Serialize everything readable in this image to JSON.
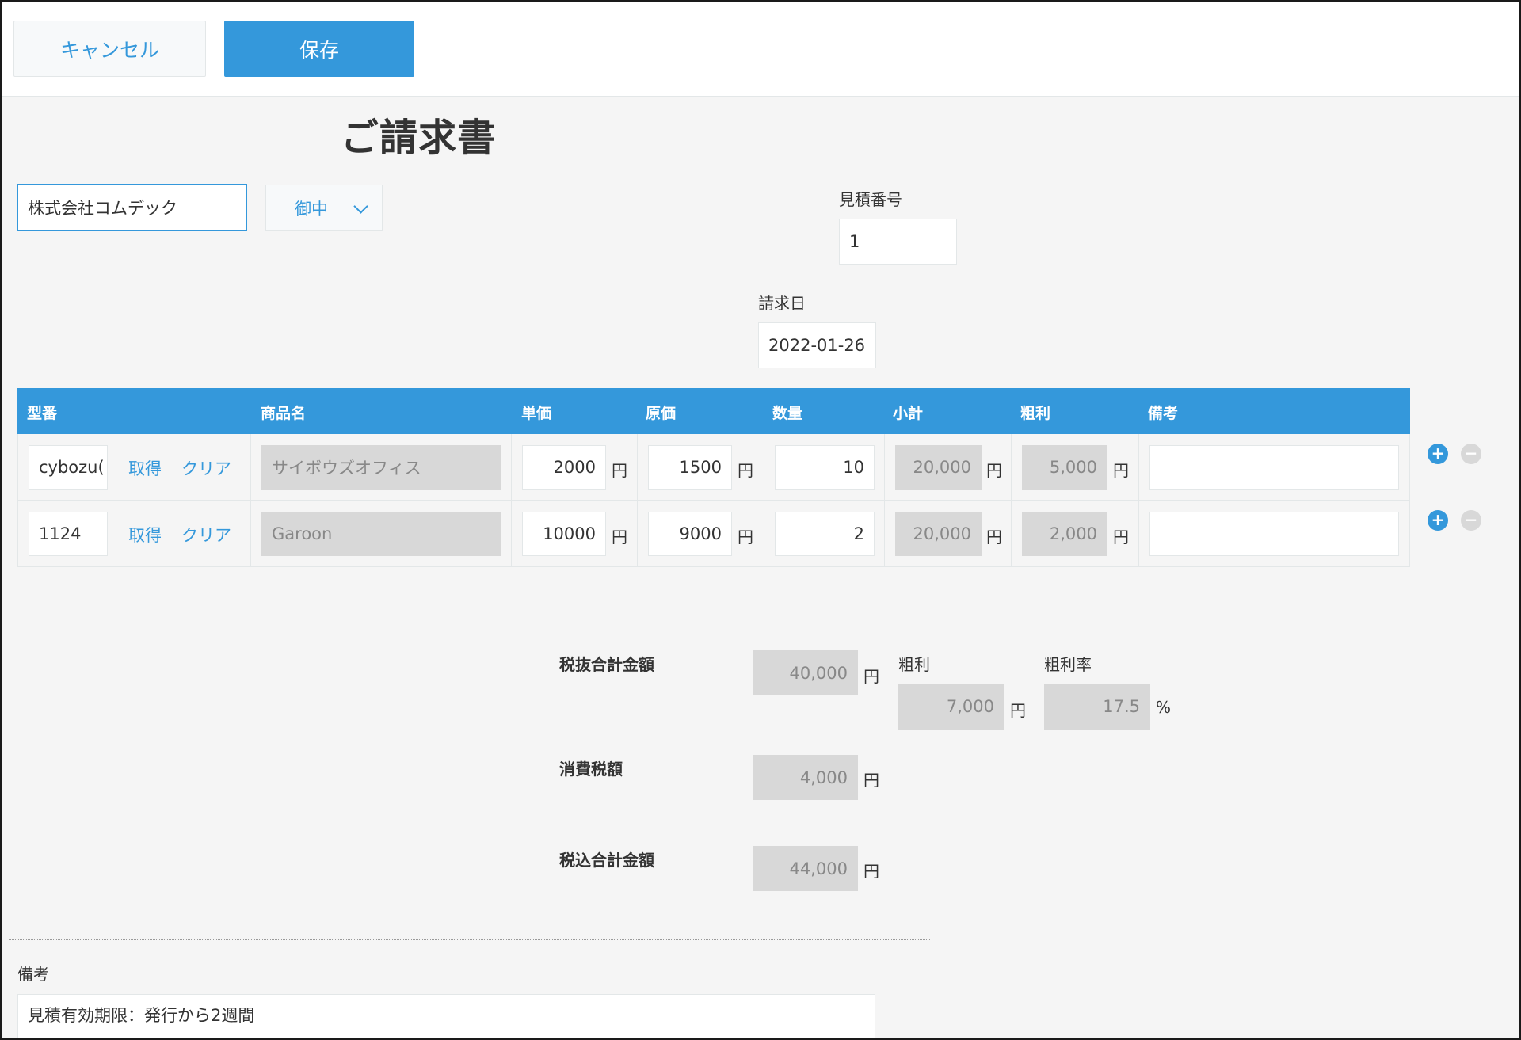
{
  "toolbar": {
    "cancel_label": "キャンセル",
    "save_label": "保存"
  },
  "title": "ご請求書",
  "customer": {
    "name": "株式会社コムデック",
    "honorific": "御中"
  },
  "estimate": {
    "label": "見積番号",
    "value": "1"
  },
  "invoice_date": {
    "label": "請求日",
    "value": "2022-01-26"
  },
  "table": {
    "headers": [
      "型番",
      "商品名",
      "単価",
      "原価",
      "数量",
      "小計",
      "粗利",
      "備考"
    ],
    "fetch_label": "取得",
    "clear_label": "クリア",
    "unit": "円",
    "rows": [
      {
        "model": "cybozu(",
        "product": "サイボウズオフィス",
        "price": "2000",
        "cost": "1500",
        "qty": "10",
        "subtotal": "20,000",
        "profit": "5,000",
        "note": ""
      },
      {
        "model": "1124",
        "product": "Garoon",
        "price": "10000",
        "cost": "9000",
        "qty": "2",
        "subtotal": "20,000",
        "profit": "2,000",
        "note": ""
      }
    ],
    "add_icon": "+",
    "remove_icon": "−"
  },
  "totals": {
    "pre_tax_label": "税抜合計金額",
    "pre_tax": "40,000",
    "profit_label": "粗利",
    "profit": "7,000",
    "profit_rate_label": "粗利率",
    "profit_rate": "17.5",
    "percent": "%",
    "tax_label": "消費税額",
    "tax": "4,000",
    "with_tax_label": "税込合計金額",
    "with_tax": "44,000",
    "unit": "円"
  },
  "remarks": {
    "label": "備考",
    "value": "見積有効期限：発行から2週間"
  },
  "colors": {
    "accent": "#3498db",
    "readonly": "#d8d8d8",
    "background": "#f5f5f5"
  }
}
